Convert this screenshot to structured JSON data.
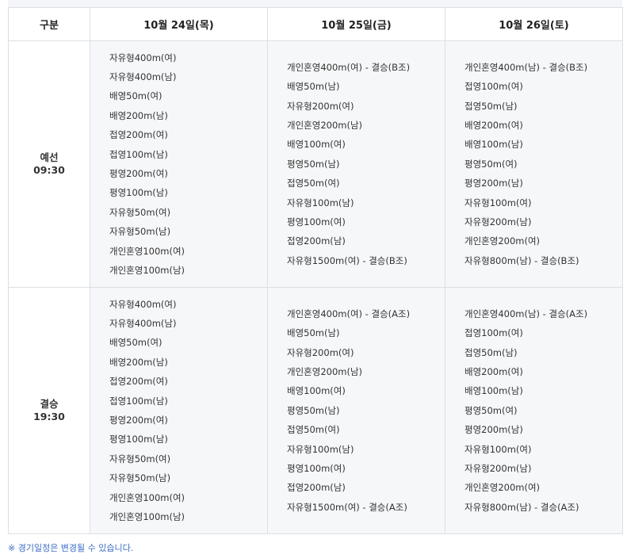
{
  "header": {
    "category": "구분",
    "days": [
      "10월 24일(목)",
      "10월 25일(금)",
      "10월 26일(토)"
    ]
  },
  "rows": [
    {
      "label": "예선",
      "time": "09:30",
      "days": [
        [
          "자유형400m(여)",
          "자유형400m(남)",
          "배영50m(여)",
          "배영200m(남)",
          "접영200m(여)",
          "접영100m(남)",
          "평영200m(여)",
          "평영100m(남)",
          "자유형50m(여)",
          "자유형50m(남)",
          "개인혼영100m(여)",
          "개인혼영100m(남)"
        ],
        [
          "개인혼영400m(여) - 결승(B조)",
          "배영50m(남)",
          "자유형200m(여)",
          "개인혼영200m(남)",
          "배영100m(여)",
          "평영50m(남)",
          "접영50m(여)",
          "자유형100m(남)",
          "평영100m(여)",
          "접영200m(남)",
          "자유형1500m(여) - 결승(B조)"
        ],
        [
          "개인혼영400m(남) - 결승(B조)",
          "접영100m(여)",
          "접영50m(남)",
          "배영200m(여)",
          "배영100m(남)",
          "평영50m(여)",
          "평영200m(남)",
          "자유형100m(여)",
          "자유형200m(남)",
          "개인혼영200m(여)",
          "자유형800m(남) - 결승(B조)"
        ]
      ]
    },
    {
      "label": "결승",
      "time": "19:30",
      "days": [
        [
          "자유형400m(여)",
          "자유형400m(남)",
          "배영50m(여)",
          "배영200m(남)",
          "접영200m(여)",
          "접영100m(남)",
          "평영200m(여)",
          "평영100m(남)",
          "자유형50m(여)",
          "자유형50m(남)",
          "개인혼영100m(여)",
          "개인혼영100m(남)"
        ],
        [
          "개인혼영400m(여) - 결승(A조)",
          "배영50m(남)",
          "자유형200m(여)",
          "개인혼영200m(남)",
          "배영100m(여)",
          "평영50m(남)",
          "접영50m(여)",
          "자유형100m(남)",
          "평영100m(여)",
          "접영200m(남)",
          "자유형1500m(여) - 결승(A조)"
        ],
        [
          "개인혼영400m(남) - 결승(A조)",
          "접영100m(여)",
          "접영50m(남)",
          "배영200m(여)",
          "배영100m(남)",
          "평영50m(여)",
          "평영200m(남)",
          "자유형100m(여)",
          "자유형200m(남)",
          "개인혼영200m(여)",
          "자유형800m(남) - 결승(A조)"
        ]
      ]
    }
  ],
  "note": "※ 경기일정은 변경될 수 있습니다."
}
